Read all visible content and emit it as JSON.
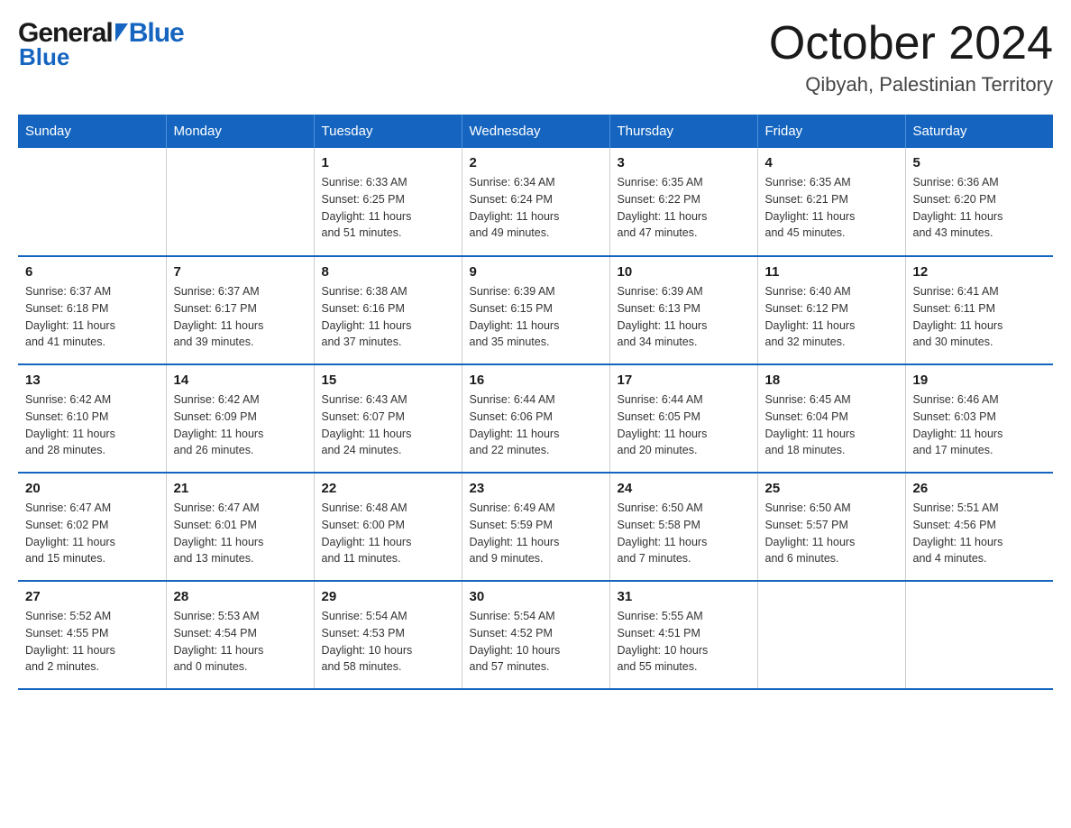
{
  "logo": {
    "general": "General",
    "blue": "Blue"
  },
  "title": "October 2024",
  "subtitle": "Qibyah, Palestinian Territory",
  "headers": [
    "Sunday",
    "Monday",
    "Tuesday",
    "Wednesday",
    "Thursday",
    "Friday",
    "Saturday"
  ],
  "weeks": [
    [
      {
        "day": "",
        "info": ""
      },
      {
        "day": "",
        "info": ""
      },
      {
        "day": "1",
        "info": "Sunrise: 6:33 AM\nSunset: 6:25 PM\nDaylight: 11 hours\nand 51 minutes."
      },
      {
        "day": "2",
        "info": "Sunrise: 6:34 AM\nSunset: 6:24 PM\nDaylight: 11 hours\nand 49 minutes."
      },
      {
        "day": "3",
        "info": "Sunrise: 6:35 AM\nSunset: 6:22 PM\nDaylight: 11 hours\nand 47 minutes."
      },
      {
        "day": "4",
        "info": "Sunrise: 6:35 AM\nSunset: 6:21 PM\nDaylight: 11 hours\nand 45 minutes."
      },
      {
        "day": "5",
        "info": "Sunrise: 6:36 AM\nSunset: 6:20 PM\nDaylight: 11 hours\nand 43 minutes."
      }
    ],
    [
      {
        "day": "6",
        "info": "Sunrise: 6:37 AM\nSunset: 6:18 PM\nDaylight: 11 hours\nand 41 minutes."
      },
      {
        "day": "7",
        "info": "Sunrise: 6:37 AM\nSunset: 6:17 PM\nDaylight: 11 hours\nand 39 minutes."
      },
      {
        "day": "8",
        "info": "Sunrise: 6:38 AM\nSunset: 6:16 PM\nDaylight: 11 hours\nand 37 minutes."
      },
      {
        "day": "9",
        "info": "Sunrise: 6:39 AM\nSunset: 6:15 PM\nDaylight: 11 hours\nand 35 minutes."
      },
      {
        "day": "10",
        "info": "Sunrise: 6:39 AM\nSunset: 6:13 PM\nDaylight: 11 hours\nand 34 minutes."
      },
      {
        "day": "11",
        "info": "Sunrise: 6:40 AM\nSunset: 6:12 PM\nDaylight: 11 hours\nand 32 minutes."
      },
      {
        "day": "12",
        "info": "Sunrise: 6:41 AM\nSunset: 6:11 PM\nDaylight: 11 hours\nand 30 minutes."
      }
    ],
    [
      {
        "day": "13",
        "info": "Sunrise: 6:42 AM\nSunset: 6:10 PM\nDaylight: 11 hours\nand 28 minutes."
      },
      {
        "day": "14",
        "info": "Sunrise: 6:42 AM\nSunset: 6:09 PM\nDaylight: 11 hours\nand 26 minutes."
      },
      {
        "day": "15",
        "info": "Sunrise: 6:43 AM\nSunset: 6:07 PM\nDaylight: 11 hours\nand 24 minutes."
      },
      {
        "day": "16",
        "info": "Sunrise: 6:44 AM\nSunset: 6:06 PM\nDaylight: 11 hours\nand 22 minutes."
      },
      {
        "day": "17",
        "info": "Sunrise: 6:44 AM\nSunset: 6:05 PM\nDaylight: 11 hours\nand 20 minutes."
      },
      {
        "day": "18",
        "info": "Sunrise: 6:45 AM\nSunset: 6:04 PM\nDaylight: 11 hours\nand 18 minutes."
      },
      {
        "day": "19",
        "info": "Sunrise: 6:46 AM\nSunset: 6:03 PM\nDaylight: 11 hours\nand 17 minutes."
      }
    ],
    [
      {
        "day": "20",
        "info": "Sunrise: 6:47 AM\nSunset: 6:02 PM\nDaylight: 11 hours\nand 15 minutes."
      },
      {
        "day": "21",
        "info": "Sunrise: 6:47 AM\nSunset: 6:01 PM\nDaylight: 11 hours\nand 13 minutes."
      },
      {
        "day": "22",
        "info": "Sunrise: 6:48 AM\nSunset: 6:00 PM\nDaylight: 11 hours\nand 11 minutes."
      },
      {
        "day": "23",
        "info": "Sunrise: 6:49 AM\nSunset: 5:59 PM\nDaylight: 11 hours\nand 9 minutes."
      },
      {
        "day": "24",
        "info": "Sunrise: 6:50 AM\nSunset: 5:58 PM\nDaylight: 11 hours\nand 7 minutes."
      },
      {
        "day": "25",
        "info": "Sunrise: 6:50 AM\nSunset: 5:57 PM\nDaylight: 11 hours\nand 6 minutes."
      },
      {
        "day": "26",
        "info": "Sunrise: 5:51 AM\nSunset: 4:56 PM\nDaylight: 11 hours\nand 4 minutes."
      }
    ],
    [
      {
        "day": "27",
        "info": "Sunrise: 5:52 AM\nSunset: 4:55 PM\nDaylight: 11 hours\nand 2 minutes."
      },
      {
        "day": "28",
        "info": "Sunrise: 5:53 AM\nSunset: 4:54 PM\nDaylight: 11 hours\nand 0 minutes."
      },
      {
        "day": "29",
        "info": "Sunrise: 5:54 AM\nSunset: 4:53 PM\nDaylight: 10 hours\nand 58 minutes."
      },
      {
        "day": "30",
        "info": "Sunrise: 5:54 AM\nSunset: 4:52 PM\nDaylight: 10 hours\nand 57 minutes."
      },
      {
        "day": "31",
        "info": "Sunrise: 5:55 AM\nSunset: 4:51 PM\nDaylight: 10 hours\nand 55 minutes."
      },
      {
        "day": "",
        "info": ""
      },
      {
        "day": "",
        "info": ""
      }
    ]
  ]
}
